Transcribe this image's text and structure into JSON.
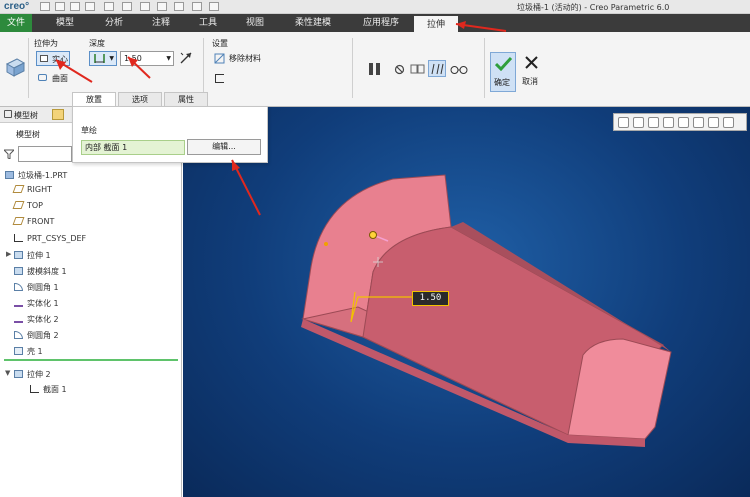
{
  "app": {
    "logo": "creo°",
    "window_title": "垃圾桶-1 (活动的) - Creo Parametric 6.0"
  },
  "menu": {
    "file": "文件",
    "tabs": [
      "模型",
      "分析",
      "注释",
      "工具",
      "视图",
      "柔性建模",
      "应用程序"
    ],
    "active_tab": "拉伸"
  },
  "ribbon": {
    "extrude_as_label": "拉伸为",
    "solid_label": "实心",
    "surface_label": "曲面",
    "depth_label": "深度",
    "depth_value": "1.50",
    "settings_label": "设置",
    "remove_material_label": "移除材料",
    "ok_label": "确定",
    "cancel_label": "取消"
  },
  "subtabs": [
    "放置",
    "选项",
    "属性"
  ],
  "placement_panel": {
    "sketch_label": "草绘",
    "sketch_value": "内部 截面 1",
    "edit_button": "编辑..."
  },
  "model_tree": {
    "tab_label": "模型树",
    "header": "模型树",
    "items": [
      {
        "label": "垃圾桶-1.PRT",
        "icon": "part-icon"
      },
      {
        "label": "RIGHT",
        "icon": "datum-plane-icon"
      },
      {
        "label": "TOP",
        "icon": "datum-plane-icon"
      },
      {
        "label": "FRONT",
        "icon": "datum-plane-icon"
      },
      {
        "label": "PRT_CSYS_DEF",
        "icon": "csys-icon"
      },
      {
        "label": "拉伸 1",
        "icon": "extrude-icon"
      },
      {
        "label": "拔模斜度 1",
        "icon": "draft-icon"
      },
      {
        "label": "倒圆角 1",
        "icon": "round-icon"
      },
      {
        "label": "实体化 1",
        "icon": "solidify-icon"
      },
      {
        "label": "实体化 2",
        "icon": "solidify-icon"
      },
      {
        "label": "倒圆角 2",
        "icon": "round-icon"
      },
      {
        "label": "壳 1",
        "icon": "shell-icon"
      }
    ],
    "active_item": {
      "label": "拉伸 2",
      "icon": "extrude-icon"
    },
    "active_child": {
      "label": "截面 1",
      "icon": "sketch-icon"
    }
  },
  "viewport": {
    "dimension_value": "1.50"
  },
  "colors": {
    "menu_bg": "#3b3b3b",
    "file_tab": "#2d8a3c",
    "model_pink": "#e8808f",
    "viewport_blue": "#103d7a",
    "annotation_red": "#e0281e"
  }
}
